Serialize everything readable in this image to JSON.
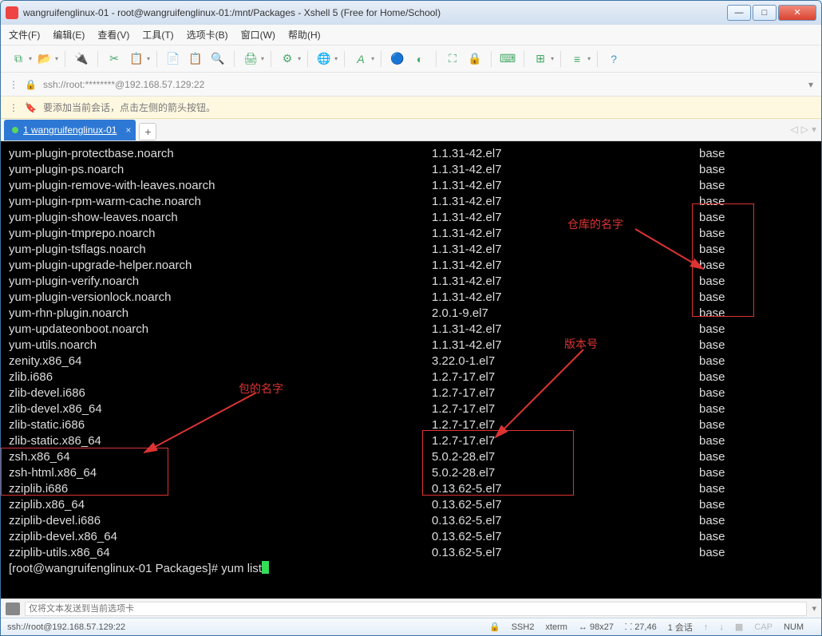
{
  "window": {
    "title": "wangruifenglinux-01 - root@wangruifenglinux-01:/mnt/Packages - Xshell 5 (Free for Home/School)"
  },
  "menu": {
    "file": "文件(F)",
    "edit": "编辑(E)",
    "view": "查看(V)",
    "tools": "工具(T)",
    "tabs": "选项卡(B)",
    "window": "窗口(W)",
    "help": "帮助(H)"
  },
  "address": {
    "url": "ssh://root:********@192.168.57.129:22"
  },
  "hint": {
    "text": "要添加当前会话，点击左侧的箭头按钮。"
  },
  "tab": {
    "label": "1 wangruifenglinux-01"
  },
  "packages": [
    {
      "name": "yum-plugin-protectbase.noarch",
      "ver": "1.1.31-42.el7",
      "repo": "base"
    },
    {
      "name": "yum-plugin-ps.noarch",
      "ver": "1.1.31-42.el7",
      "repo": "base"
    },
    {
      "name": "yum-plugin-remove-with-leaves.noarch",
      "ver": "1.1.31-42.el7",
      "repo": "base"
    },
    {
      "name": "yum-plugin-rpm-warm-cache.noarch",
      "ver": "1.1.31-42.el7",
      "repo": "base"
    },
    {
      "name": "yum-plugin-show-leaves.noarch",
      "ver": "1.1.31-42.el7",
      "repo": "base"
    },
    {
      "name": "yum-plugin-tmprepo.noarch",
      "ver": "1.1.31-42.el7",
      "repo": "base"
    },
    {
      "name": "yum-plugin-tsflags.noarch",
      "ver": "1.1.31-42.el7",
      "repo": "base"
    },
    {
      "name": "yum-plugin-upgrade-helper.noarch",
      "ver": "1.1.31-42.el7",
      "repo": "base"
    },
    {
      "name": "yum-plugin-verify.noarch",
      "ver": "1.1.31-42.el7",
      "repo": "base"
    },
    {
      "name": "yum-plugin-versionlock.noarch",
      "ver": "1.1.31-42.el7",
      "repo": "base"
    },
    {
      "name": "yum-rhn-plugin.noarch",
      "ver": "2.0.1-9.el7",
      "repo": "base"
    },
    {
      "name": "yum-updateonboot.noarch",
      "ver": "1.1.31-42.el7",
      "repo": "base"
    },
    {
      "name": "yum-utils.noarch",
      "ver": "1.1.31-42.el7",
      "repo": "base"
    },
    {
      "name": "zenity.x86_64",
      "ver": "3.22.0-1.el7",
      "repo": "base"
    },
    {
      "name": "zlib.i686",
      "ver": "1.2.7-17.el7",
      "repo": "base"
    },
    {
      "name": "zlib-devel.i686",
      "ver": "1.2.7-17.el7",
      "repo": "base"
    },
    {
      "name": "zlib-devel.x86_64",
      "ver": "1.2.7-17.el7",
      "repo": "base"
    },
    {
      "name": "zlib-static.i686",
      "ver": "1.2.7-17.el7",
      "repo": "base"
    },
    {
      "name": "zlib-static.x86_64",
      "ver": "1.2.7-17.el7",
      "repo": "base"
    },
    {
      "name": "zsh.x86_64",
      "ver": "5.0.2-28.el7",
      "repo": "base"
    },
    {
      "name": "zsh-html.x86_64",
      "ver": "5.0.2-28.el7",
      "repo": "base"
    },
    {
      "name": "zziplib.i686",
      "ver": "0.13.62-5.el7",
      "repo": "base"
    },
    {
      "name": "zziplib.x86_64",
      "ver": "0.13.62-5.el7",
      "repo": "base"
    },
    {
      "name": "zziplib-devel.i686",
      "ver": "0.13.62-5.el7",
      "repo": "base"
    },
    {
      "name": "zziplib-devel.x86_64",
      "ver": "0.13.62-5.el7",
      "repo": "base"
    },
    {
      "name": "zziplib-utils.x86_64",
      "ver": "0.13.62-5.el7",
      "repo": "base"
    }
  ],
  "prompt": {
    "full": "[root@wangruifenglinux-01 Packages]# yum list"
  },
  "annot": {
    "pkg": "包的名字",
    "ver": "版本号",
    "repo": "仓库的名字"
  },
  "sendbar": {
    "placeholder": "仅将文本发送到当前选项卡"
  },
  "status": {
    "conn": "ssh://root@192.168.57.129:22",
    "ssh": "SSH2",
    "term": "xterm",
    "size": "98x27",
    "pos": "27,46",
    "sess": "1 会话",
    "cap": "CAP",
    "num": "NUM"
  }
}
